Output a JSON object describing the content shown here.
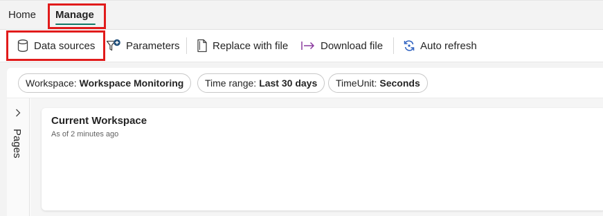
{
  "tabs": {
    "home": "Home",
    "manage": "Manage"
  },
  "toolbar": {
    "data_sources": "Data sources",
    "parameters": "Parameters",
    "replace_with_file": "Replace with file",
    "download_file": "Download file",
    "auto_refresh": "Auto refresh"
  },
  "filters": {
    "workspace": {
      "label": "Workspace:",
      "value": "Workspace Monitoring"
    },
    "time_range": {
      "label": "Time range:",
      "value": "Last 30 days"
    },
    "time_unit": {
      "label": "TimeUnit:",
      "value": "Seconds"
    }
  },
  "pages_pane": {
    "label": "Pages"
  },
  "card": {
    "title": "Current Workspace",
    "subtitle": "As of 2 minutes ago"
  },
  "icons": {
    "data_sources": "database-icon",
    "parameters": "filter-add-icon",
    "replace": "document-icon",
    "download": "arrow-export-icon",
    "refresh": "refresh-icon",
    "expand": "chevron-right-icon"
  },
  "colors": {
    "accent": "#117865",
    "highlight": "#e11b1b",
    "download_icon": "#8a3a9e",
    "refresh_icon": "#2b5fbf"
  }
}
